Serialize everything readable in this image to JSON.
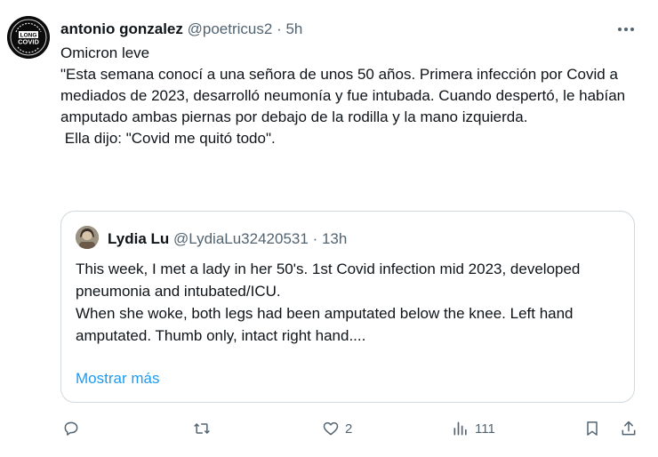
{
  "tweet": {
    "author_name": "antonio gonzalez",
    "handle": "@poetricus2",
    "separator": "·",
    "time": "5h",
    "avatar_lettering": [
      "LONG COVID",
      "LONG",
      "COVID",
      "AWARENESS"
    ],
    "paragraphs": [
      "Omicron leve",
      "",
      "\"Esta semana conocí a una señora de unos 50 años. Primera infección por Covid a mediados de 2023, desarrolló neumonía y fue intubada. Cuando despertó, le habían amputado ambas piernas por debajo de la rodilla y la mano izquierda.",
      " Ella dijo: \"Covid me quitó todo\"."
    ]
  },
  "quoted": {
    "author_name": "Lydia Lu",
    "handle": "@LydiaLu32420531",
    "separator": "·",
    "time": "13h",
    "paragraphs": [
      "This week, I met a lady in her 50's. 1st Covid infection mid 2023, developed pneumonia and intubated/ICU.",
      "",
      "When she woke, both legs had been amputated below the knee. Left hand amputated. Thumb only, intact right hand...."
    ],
    "show_more": "Mostrar más"
  },
  "actions": {
    "reply": {
      "icon": "reply-icon",
      "count": ""
    },
    "retweet": {
      "icon": "retweet-icon",
      "count": ""
    },
    "like": {
      "icon": "heart-icon",
      "count": "2"
    },
    "views": {
      "icon": "views-icon",
      "count": "111"
    },
    "bookmark": {
      "icon": "bookmark-icon"
    },
    "share": {
      "icon": "share-icon"
    }
  },
  "colors": {
    "text": "#0f1419",
    "secondary": "#536471",
    "link": "#1d9bf0",
    "border": "#cfd9de"
  }
}
